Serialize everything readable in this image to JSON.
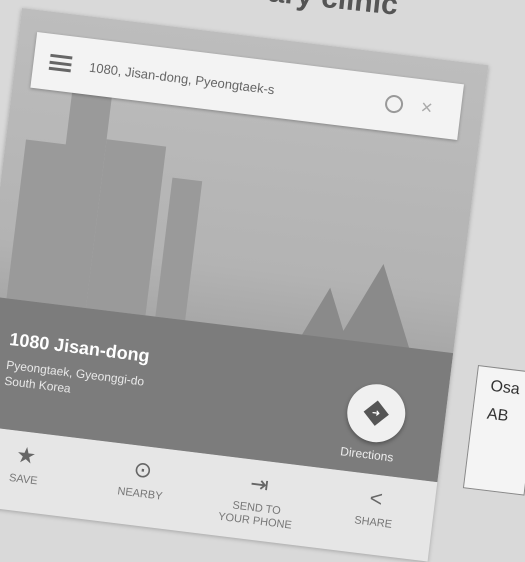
{
  "page": {
    "title": "ary clinic"
  },
  "search": {
    "value": "1080, Jisan-dong, Pyeongtaek-s"
  },
  "place": {
    "name": "1080 Jisan-dong",
    "line1": "Pyeongtaek, Gyeonggi-do",
    "line2": "South Korea"
  },
  "directions": {
    "label": "Directions"
  },
  "actions": {
    "save": "SAVE",
    "nearby": "NEARBY",
    "send_line1": "SEND TO",
    "send_line2": "YOUR PHONE",
    "share": "SHARE"
  },
  "side": {
    "line1": "Osa",
    "line2": "AB"
  }
}
